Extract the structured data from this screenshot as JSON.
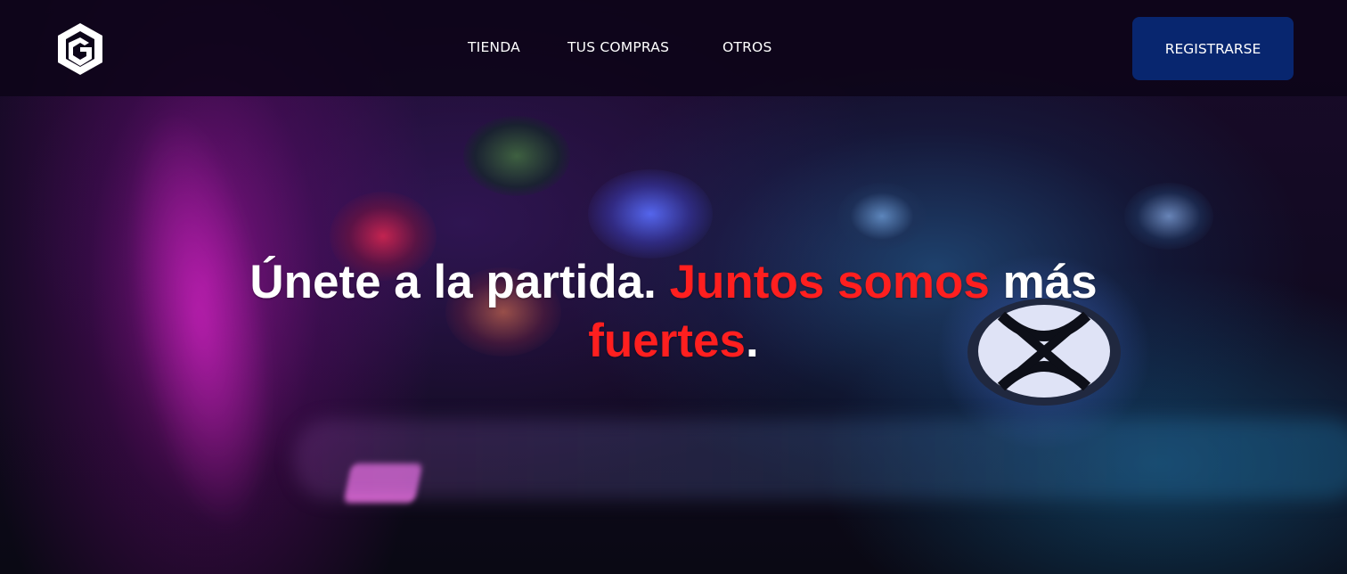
{
  "colors": {
    "accent": "#ff1f1f",
    "button_bg": "#08266f",
    "nav_bg": "#0c0418",
    "text": "#ffffff"
  },
  "header": {
    "logo_icon": "cube-g-logo-icon",
    "nav": [
      {
        "label": "TIENDA"
      },
      {
        "label": "TUS COMPRAS"
      },
      {
        "label": "OTROS"
      }
    ],
    "register_label": "REGISTRARSE"
  },
  "hero": {
    "background": "gamepad-photo",
    "headline": {
      "part1": "Únete a la partida. ",
      "accent1": "Juntos somos",
      "part2": " más ",
      "accent2": "fuertes",
      "part3": "."
    }
  }
}
